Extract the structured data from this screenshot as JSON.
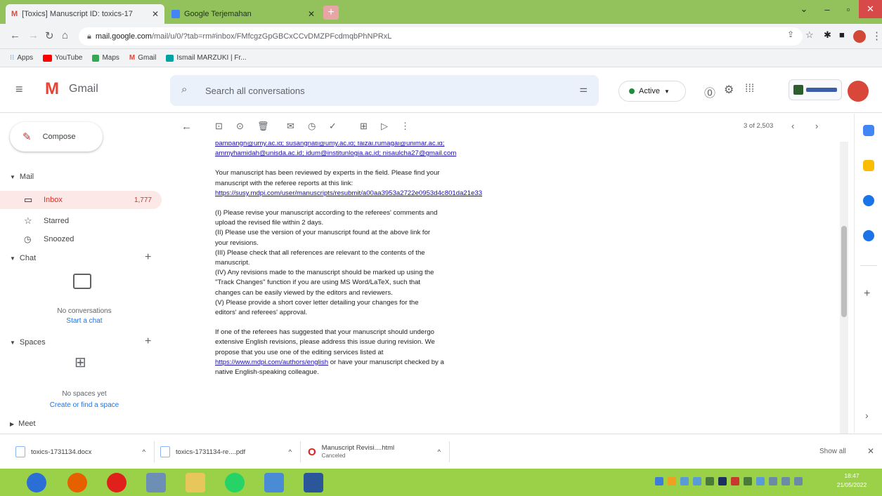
{
  "browser": {
    "tabs": [
      {
        "label": "[Toxics] Manuscript ID: toxics-17",
        "icon": "gmail-icon",
        "active": true
      },
      {
        "label": "Google Terjemahan",
        "icon": "google-translate-icon",
        "active": false
      }
    ],
    "url_domain": "mail.google.com",
    "url_path": "/mail/u/0/?tab=rm#inbox/FMfcgzGpGBCxCCvDMZPFcdmqbPhNPRxL",
    "bookmarks": [
      "Apps",
      "YouTube",
      "Maps",
      "Gmail",
      "Ismail MARZUKI | Fr..."
    ]
  },
  "gmail": {
    "app_name": "Gmail",
    "search_placeholder": "Search all conversations",
    "status": "Active",
    "pagination": "3 of 2,503"
  },
  "sidebar": {
    "compose": "Compose",
    "mail_section": "Mail",
    "items": [
      {
        "label": "Inbox",
        "count": "1,777"
      },
      {
        "label": "Starred",
        "count": ""
      },
      {
        "label": "Snoozed",
        "count": ""
      }
    ],
    "chat_section": "Chat",
    "chat_empty": "No conversations",
    "chat_start": "Start a chat",
    "spaces_section": "Spaces",
    "spaces_empty": "No spaces yet",
    "spaces_create": "Create or find a space",
    "meet_section": "Meet"
  },
  "message": {
    "emails_line1": "bambangh@umy.ac.id; susangnati@umy.ac.id; faizal.rumagal@unimar.ac.id;",
    "emails_line2": "ammyhamidah@unisda.ac.id; idum@institunlogia.ac.id; nisaulcha27@gmail.com",
    "p1_lines": [
      "Your manuscript has been reviewed by experts in the field. Please find your",
      "manuscript with the referee reports at this link:"
    ],
    "review_link": "https://susy.mdpi.com/user/manuscripts/resubmit/a00aa3953a2722e0953d4c801da21e33",
    "instructions": [
      "(I) Please revise your manuscript according to the referees' comments and",
      "upload the revised file within 2 days.",
      "(II) Please use the version of your manuscript found at the above link for",
      "your revisions.",
      "(III) Please check that all references are relevant to the contents of the",
      "manuscript.",
      "(IV) Any revisions made to the manuscript should be marked up using the",
      "\"Track Changes\" function if you are using MS Word/LaTeX, such that",
      "changes can be easily viewed by the editors and reviewers.",
      "(V) Please provide a short cover letter detailing your changes for the",
      "editors' and referees' approval."
    ],
    "p3_lines": [
      "If one of the referees has suggested that your manuscript should undergo",
      "extensive English revisions, please address this issue during revision. We",
      "propose that you use one of the editing services listed at"
    ],
    "english_link": "https://www.mdpi.com/authors/english",
    "p3_tail": " or have your manuscript checked by a",
    "p3_last": "native English-speaking colleague."
  },
  "downloads": {
    "items": [
      {
        "name": "toxics-1731134.docx",
        "status": ""
      },
      {
        "name": "toxics-1731134-re....pdf",
        "status": ""
      },
      {
        "name": "Manuscript Revisi....html",
        "status": "Canceled"
      }
    ],
    "show_all": "Show all"
  },
  "taskbar": {
    "time": "18:47",
    "date": "21/05/2022"
  },
  "colors": {
    "titlebar": "#93c15c",
    "taskbar": "#9bd049",
    "gmail_red": "#ea4335",
    "link": "#1a0dab"
  }
}
